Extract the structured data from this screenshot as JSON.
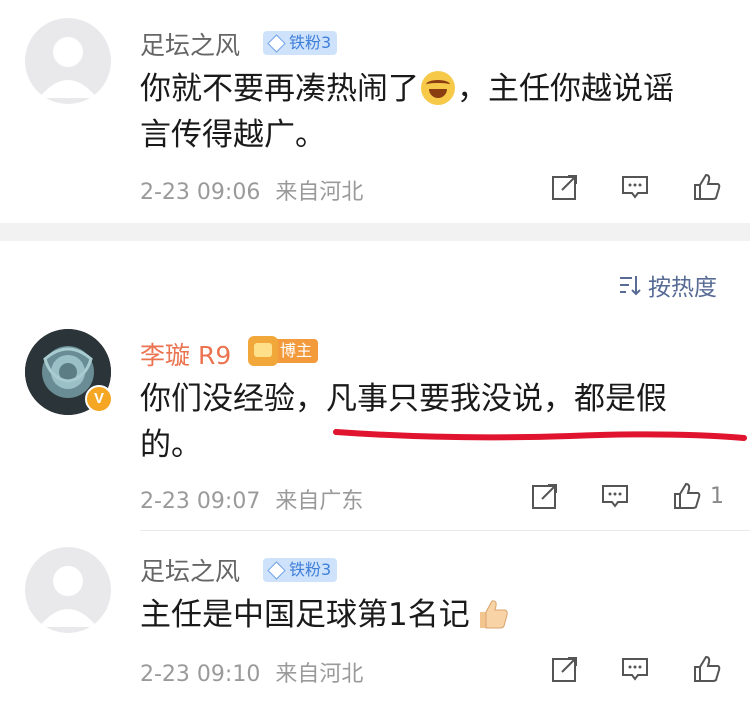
{
  "comments": [
    {
      "username": "足坛之风",
      "badge": "铁粉3",
      "text_before": "你就不要再凑热闹了",
      "text_after": "，主任你越说谣言传得越广。",
      "time": "2-23 09:06",
      "location": "来自河北",
      "likes": ""
    },
    {
      "username": "李璇 R9",
      "badge": "博主",
      "text": "你们没经验，凡事只要我没说，都是假的。",
      "time": "2-23 09:07",
      "location": "来自广东",
      "likes": "1"
    },
    {
      "username": "足坛之风",
      "badge": "铁粉3",
      "text": "主任是中国足球第1名记",
      "time": "2-23 09:10",
      "location": "来自河北",
      "likes": ""
    }
  ],
  "sort": {
    "label": "按热度"
  },
  "icons": {
    "share": "share-icon",
    "comment": "comment-icon",
    "like": "like-icon",
    "emoji_laugh": "laughing-tears-emoji",
    "emoji_thumb": "thumbs-up-emoji"
  },
  "colors": {
    "username_gray": "#666666",
    "blogger_orange": "#eb7350",
    "fan_badge_bg": "#cfe2fb",
    "fan_badge_text": "#3f7fd8",
    "meta_gray": "#9a9a9a",
    "sort_blue": "#576b95",
    "annotation_red": "#e0142e"
  }
}
